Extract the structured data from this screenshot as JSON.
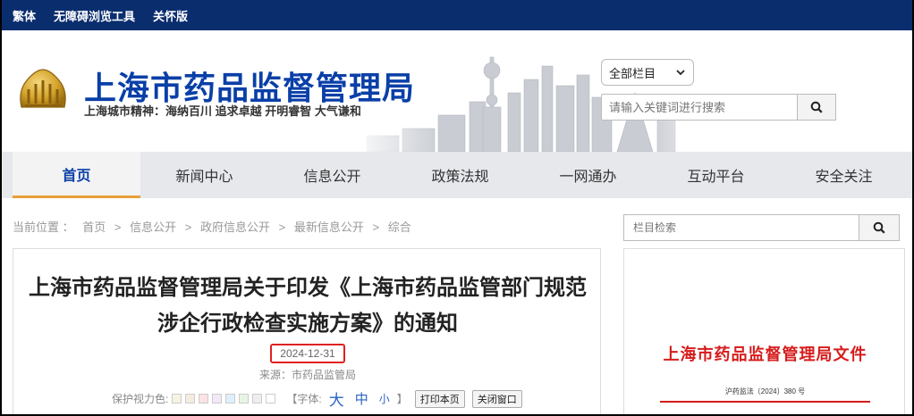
{
  "topbar": {
    "links": [
      "繁体",
      "无障碍浏览工具",
      "关怀版"
    ]
  },
  "header": {
    "title": "上海市药品监督管理局",
    "motto": "上海城市精神：海纳百川  追求卓越  开明睿智  大气谦和",
    "scope_select": "全部栏目",
    "search_placeholder": "请输入关键词进行搜索"
  },
  "nav": {
    "items": [
      "首页",
      "新闻中心",
      "信息公开",
      "政策法规",
      "一网通办",
      "互动平台",
      "安全关注"
    ],
    "active_index": 0
  },
  "breadcrumb": {
    "label": "当前位置 ：",
    "items": [
      "首页",
      "信息公开",
      "政府信息公开",
      "最新信息公开",
      "综合"
    ],
    "separator": ">"
  },
  "article": {
    "title_line1": "上海市药品监督管理局关于印发《上海市药品监管部门规范",
    "title_line2": "涉企行政检查实施方案》的通知",
    "date": "2024-12-31",
    "source": "来源：市药品监管局",
    "protect_label": "保护视力色:",
    "swatch_colors": [
      "#f7f3e3",
      "#f5ece0",
      "#fbe3e3",
      "#f3e8f7",
      "#def0fb",
      "#e6f6e6",
      "#eeeeee",
      "#ffffff"
    ],
    "font_label": "【字体:",
    "font_big": "大",
    "font_mid": "中",
    "font_small": "小",
    "font_close": "】",
    "print_button": "打印本页",
    "close_button": "关闭窗口"
  },
  "sidebar": {
    "search_placeholder": "栏目检索",
    "doc_heading": "上海市药品监督管理局文件",
    "doc_number": "沪药监法〔2024〕380 号"
  },
  "colors": {
    "topbar_bg": "#0a2d6e",
    "title_blue": "#0a3fa8",
    "nav_bg": "#e6e8ec",
    "nav_active_underline": "#e8a03a",
    "date_highlight": "#e02020",
    "doc_red": "#d61c1c"
  }
}
